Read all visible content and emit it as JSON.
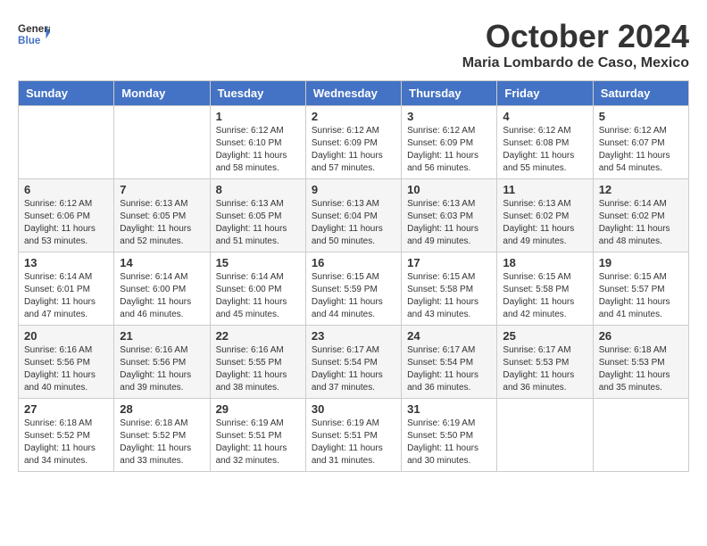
{
  "header": {
    "logo_general": "General",
    "logo_blue": "Blue",
    "month_title": "October 2024",
    "subtitle": "Maria Lombardo de Caso, Mexico"
  },
  "weekdays": [
    "Sunday",
    "Monday",
    "Tuesday",
    "Wednesday",
    "Thursday",
    "Friday",
    "Saturday"
  ],
  "weeks": [
    [
      {
        "day": "",
        "info": ""
      },
      {
        "day": "",
        "info": ""
      },
      {
        "day": "1",
        "info": "Sunrise: 6:12 AM\nSunset: 6:10 PM\nDaylight: 11 hours and 58 minutes."
      },
      {
        "day": "2",
        "info": "Sunrise: 6:12 AM\nSunset: 6:09 PM\nDaylight: 11 hours and 57 minutes."
      },
      {
        "day": "3",
        "info": "Sunrise: 6:12 AM\nSunset: 6:09 PM\nDaylight: 11 hours and 56 minutes."
      },
      {
        "day": "4",
        "info": "Sunrise: 6:12 AM\nSunset: 6:08 PM\nDaylight: 11 hours and 55 minutes."
      },
      {
        "day": "5",
        "info": "Sunrise: 6:12 AM\nSunset: 6:07 PM\nDaylight: 11 hours and 54 minutes."
      }
    ],
    [
      {
        "day": "6",
        "info": "Sunrise: 6:12 AM\nSunset: 6:06 PM\nDaylight: 11 hours and 53 minutes."
      },
      {
        "day": "7",
        "info": "Sunrise: 6:13 AM\nSunset: 6:05 PM\nDaylight: 11 hours and 52 minutes."
      },
      {
        "day": "8",
        "info": "Sunrise: 6:13 AM\nSunset: 6:05 PM\nDaylight: 11 hours and 51 minutes."
      },
      {
        "day": "9",
        "info": "Sunrise: 6:13 AM\nSunset: 6:04 PM\nDaylight: 11 hours and 50 minutes."
      },
      {
        "day": "10",
        "info": "Sunrise: 6:13 AM\nSunset: 6:03 PM\nDaylight: 11 hours and 49 minutes."
      },
      {
        "day": "11",
        "info": "Sunrise: 6:13 AM\nSunset: 6:02 PM\nDaylight: 11 hours and 49 minutes."
      },
      {
        "day": "12",
        "info": "Sunrise: 6:14 AM\nSunset: 6:02 PM\nDaylight: 11 hours and 48 minutes."
      }
    ],
    [
      {
        "day": "13",
        "info": "Sunrise: 6:14 AM\nSunset: 6:01 PM\nDaylight: 11 hours and 47 minutes."
      },
      {
        "day": "14",
        "info": "Sunrise: 6:14 AM\nSunset: 6:00 PM\nDaylight: 11 hours and 46 minutes."
      },
      {
        "day": "15",
        "info": "Sunrise: 6:14 AM\nSunset: 6:00 PM\nDaylight: 11 hours and 45 minutes."
      },
      {
        "day": "16",
        "info": "Sunrise: 6:15 AM\nSunset: 5:59 PM\nDaylight: 11 hours and 44 minutes."
      },
      {
        "day": "17",
        "info": "Sunrise: 6:15 AM\nSunset: 5:58 PM\nDaylight: 11 hours and 43 minutes."
      },
      {
        "day": "18",
        "info": "Sunrise: 6:15 AM\nSunset: 5:58 PM\nDaylight: 11 hours and 42 minutes."
      },
      {
        "day": "19",
        "info": "Sunrise: 6:15 AM\nSunset: 5:57 PM\nDaylight: 11 hours and 41 minutes."
      }
    ],
    [
      {
        "day": "20",
        "info": "Sunrise: 6:16 AM\nSunset: 5:56 PM\nDaylight: 11 hours and 40 minutes."
      },
      {
        "day": "21",
        "info": "Sunrise: 6:16 AM\nSunset: 5:56 PM\nDaylight: 11 hours and 39 minutes."
      },
      {
        "day": "22",
        "info": "Sunrise: 6:16 AM\nSunset: 5:55 PM\nDaylight: 11 hours and 38 minutes."
      },
      {
        "day": "23",
        "info": "Sunrise: 6:17 AM\nSunset: 5:54 PM\nDaylight: 11 hours and 37 minutes."
      },
      {
        "day": "24",
        "info": "Sunrise: 6:17 AM\nSunset: 5:54 PM\nDaylight: 11 hours and 36 minutes."
      },
      {
        "day": "25",
        "info": "Sunrise: 6:17 AM\nSunset: 5:53 PM\nDaylight: 11 hours and 36 minutes."
      },
      {
        "day": "26",
        "info": "Sunrise: 6:18 AM\nSunset: 5:53 PM\nDaylight: 11 hours and 35 minutes."
      }
    ],
    [
      {
        "day": "27",
        "info": "Sunrise: 6:18 AM\nSunset: 5:52 PM\nDaylight: 11 hours and 34 minutes."
      },
      {
        "day": "28",
        "info": "Sunrise: 6:18 AM\nSunset: 5:52 PM\nDaylight: 11 hours and 33 minutes."
      },
      {
        "day": "29",
        "info": "Sunrise: 6:19 AM\nSunset: 5:51 PM\nDaylight: 11 hours and 32 minutes."
      },
      {
        "day": "30",
        "info": "Sunrise: 6:19 AM\nSunset: 5:51 PM\nDaylight: 11 hours and 31 minutes."
      },
      {
        "day": "31",
        "info": "Sunrise: 6:19 AM\nSunset: 5:50 PM\nDaylight: 11 hours and 30 minutes."
      },
      {
        "day": "",
        "info": ""
      },
      {
        "day": "",
        "info": ""
      }
    ]
  ]
}
